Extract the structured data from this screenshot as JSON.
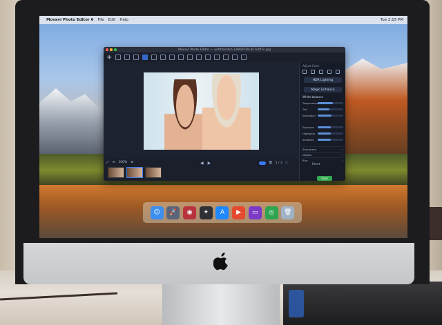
{
  "os_menubar": {
    "app_name": "Movavi Photo Editor 6",
    "menus": [
      "File",
      "Edit",
      "Help"
    ],
    "status_right": [
      "Tue 2:15 PM"
    ]
  },
  "window": {
    "title": "Movavi Photo Editor — untitled-bm-1486975b-8c7e0f7c.jpg"
  },
  "toolbar": {
    "tools": [
      "add",
      "enhance",
      "adjust",
      "retouch",
      "crop",
      "rotate",
      "text",
      "transform",
      "effects",
      "watermark",
      "frames",
      "object-removal",
      "background",
      "share",
      "gear",
      "export"
    ],
    "active_index": 0
  },
  "canvas": {
    "zoom_label": "100%",
    "nav_prev": "◀",
    "nav_next": "▶",
    "page_label": "1 / 3"
  },
  "filmstrip": {
    "thumbnails": [
      "photo-1",
      "photo-2",
      "photo-3"
    ],
    "selected_index": 1
  },
  "right_panel": {
    "title": "Adjust Color",
    "buttons": [
      "HDR Lighting",
      "Magic Enhance"
    ],
    "white_balance_label": "White balance",
    "sliders": [
      {
        "label": "Temperature",
        "value": 0.6
      },
      {
        "label": "Tint",
        "value": 0.45
      },
      {
        "label": "Saturation",
        "value": 0.55
      },
      {
        "label": "Exposure",
        "value": 0.5
      },
      {
        "label": "Highlights",
        "value": 0.5
      },
      {
        "label": "Shadows",
        "value": 0.5
      }
    ],
    "accordions": [
      "Sharpness",
      "Details",
      "Blur"
    ],
    "reset_label": "Reset",
    "save_label": "Save"
  },
  "dock": {
    "apps": [
      {
        "name": "finder",
        "color": "#3c8ef0",
        "glyph": "☺"
      },
      {
        "name": "launchpad",
        "color": "#59657a",
        "glyph": "🚀"
      },
      {
        "name": "photo-booth",
        "color": "#b8333d",
        "glyph": "◉"
      },
      {
        "name": "final-cut",
        "color": "#2f2f36",
        "glyph": "✦"
      },
      {
        "name": "app-store",
        "color": "#1f87ff",
        "glyph": "A"
      },
      {
        "name": "movavi",
        "color": "#e54a2e",
        "glyph": "▶"
      },
      {
        "name": "display",
        "color": "#7c3ac7",
        "glyph": "▭"
      },
      {
        "name": "chrome",
        "color": "#2ea44f",
        "glyph": "◎"
      },
      {
        "name": "trash",
        "color": "#9fb3c7",
        "glyph": "🗑"
      }
    ]
  },
  "colors": {
    "accent": "#3d7bf2",
    "save": "#35a852",
    "window_bg": "#1d2331"
  }
}
